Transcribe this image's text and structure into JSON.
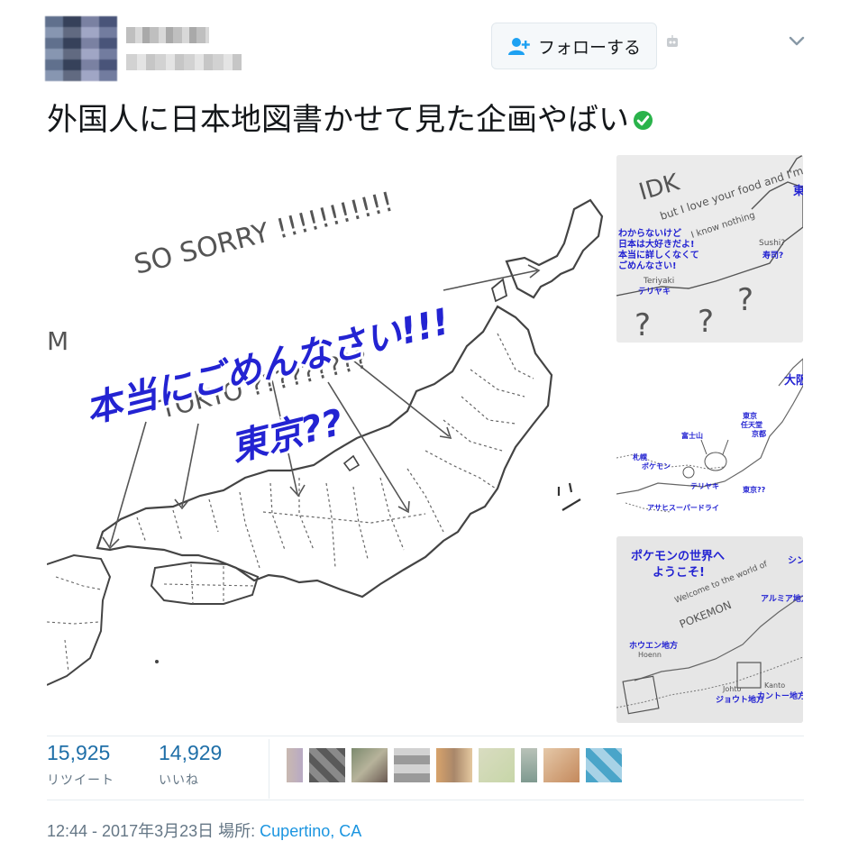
{
  "tweet": {
    "follow_button_label": "フォローする",
    "text": "外国人に日本地図書かせて見た企画やばい",
    "images": {
      "main": {
        "handwriting": [
          "SO SORRY !!!!!!!!!!!",
          "M",
          "TOKYO ?????????"
        ],
        "overlay_lines": [
          "本当にごめんなさい!!!",
          "東京??"
        ]
      },
      "side1": {
        "handwriting": [
          "IDK",
          "but I love your food and I'm sorry",
          "I know nothing",
          "Teriyaki",
          "Sushi?"
        ],
        "overlay_lines": [
          "わからないけど",
          "日本は大好きだよ!",
          "本当に詳しくなくて",
          "ごめんなさい!"
        ],
        "labels": [
          "寿司?",
          "テリヤキ",
          "東"
        ]
      },
      "side2": {
        "labels": [
          "大阪",
          "富士山",
          "札幌",
          "東京",
          "京都",
          "任天堂",
          "東京??",
          "ポケモン",
          "アサヒスーパードライ",
          "テリヤキ"
        ]
      },
      "side3": {
        "overlay_lines": [
          "ポケモンの世界へ",
          "ようこそ!"
        ],
        "handwriting": [
          "Welcome to the world of",
          "POKEMON",
          "Hoenn",
          "Johto",
          "Kanto"
        ],
        "labels": [
          "ホウエン地方",
          "ジョウト地方",
          "カントー地方",
          "アルミア地方",
          "シン"
        ]
      }
    },
    "stats": {
      "retweets": {
        "count": "15,925",
        "label": "リツイート"
      },
      "likes": {
        "count": "14,929",
        "label": "いいね"
      }
    },
    "time": "12:44 - 2017年3月23日",
    "place_prefix": "場所:",
    "place": "Cupertino, CA"
  },
  "icons": {
    "follow": "person-plus-icon",
    "verified": "checkmark-circle-icon",
    "menu": "chevron-down-icon",
    "robot": "robot-icon"
  },
  "colors": {
    "link": "#1b95e0",
    "verified": "#2ab34b",
    "overlay_blue": "#2323d2",
    "muted": "#657786",
    "count": "#1f6fa8"
  }
}
